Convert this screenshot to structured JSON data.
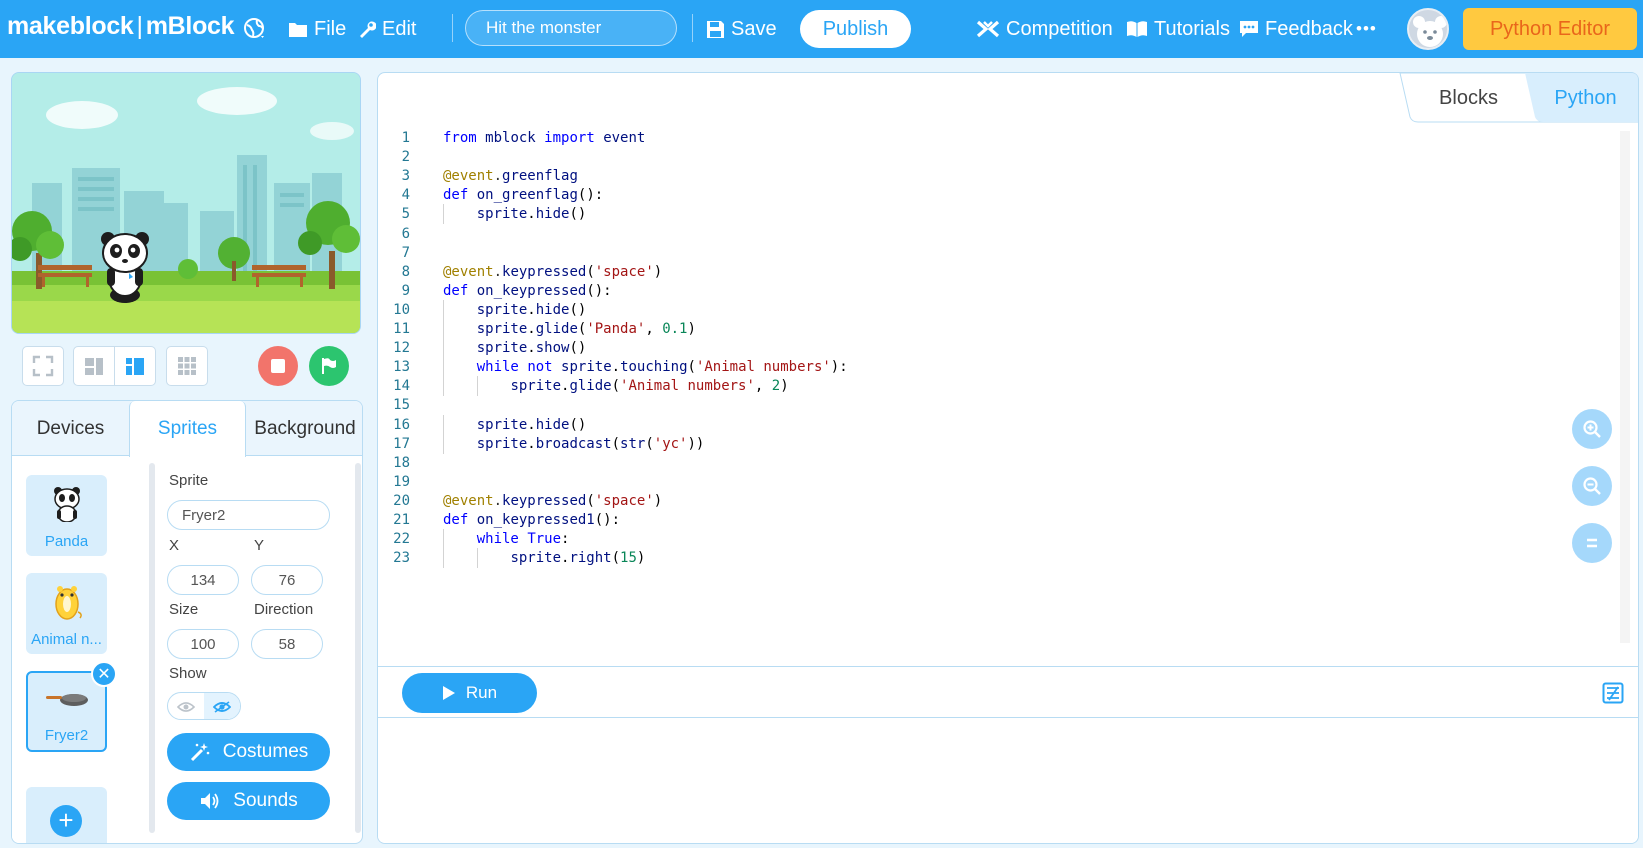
{
  "app": {
    "brand_left": "makeblock",
    "brand_sep": "|",
    "brand_right": "mBlock"
  },
  "topbar": {
    "file_label": "File",
    "edit_label": "Edit",
    "project_name": "Hit the monster",
    "save_label": "Save",
    "publish_label": "Publish",
    "competition_label": "Competition",
    "tutorials_label": "Tutorials",
    "feedback_label": "Feedback",
    "more_label": "•••",
    "python_editor_label": "Python Editor"
  },
  "left_panel": {
    "tabs": [
      {
        "label": "Devices",
        "active": false
      },
      {
        "label": "Sprites",
        "active": true
      },
      {
        "label": "Background",
        "active": false
      }
    ],
    "sprites": [
      {
        "label": "Panda",
        "selected": false
      },
      {
        "label": "Animal n...",
        "selected": false
      },
      {
        "label": "Fryer2",
        "selected": true
      }
    ],
    "add_label": "+",
    "delete_label": "✕",
    "props": {
      "sprite_label": "Sprite",
      "sprite_value": "Fryer2",
      "x_label": "X",
      "x_value": "134",
      "y_label": "Y",
      "y_value": "76",
      "size_label": "Size",
      "size_value": "100",
      "direction_label": "Direction",
      "direction_value": "58",
      "show_label": "Show",
      "costumes_label": "Costumes",
      "sounds_label": "Sounds"
    }
  },
  "editor": {
    "mode_tabs": [
      {
        "label": "Blocks",
        "active": false
      },
      {
        "label": "Python",
        "active": true
      }
    ],
    "run_label": "Run",
    "code_lines": [
      {
        "n": "1",
        "text": "from mblock import event"
      },
      {
        "n": "2",
        "text": ""
      },
      {
        "n": "3",
        "text": "@event.greenflag"
      },
      {
        "n": "4",
        "text": "def on_greenflag():"
      },
      {
        "n": "5",
        "text": "    sprite.hide()"
      },
      {
        "n": "6",
        "text": ""
      },
      {
        "n": "7",
        "text": ""
      },
      {
        "n": "8",
        "text": "@event.keypressed('space')"
      },
      {
        "n": "9",
        "text": "def on_keypressed():"
      },
      {
        "n": "10",
        "text": "    sprite.hide()"
      },
      {
        "n": "11",
        "text": "    sprite.glide('Panda', 0.1)"
      },
      {
        "n": "12",
        "text": "    sprite.show()"
      },
      {
        "n": "13",
        "text": "    while not sprite.touching('Animal numbers'):"
      },
      {
        "n": "14",
        "text": "        sprite.glide('Animal numbers', 2)"
      },
      {
        "n": "15",
        "text": ""
      },
      {
        "n": "16",
        "text": "    sprite.hide()"
      },
      {
        "n": "17",
        "text": "    sprite.broadcast(str('yc'))"
      },
      {
        "n": "18",
        "text": ""
      },
      {
        "n": "19",
        "text": ""
      },
      {
        "n": "20",
        "text": "@event.keypressed('space')"
      },
      {
        "n": "21",
        "text": "def on_keypressed1():"
      },
      {
        "n": "22",
        "text": "    while True:"
      },
      {
        "n": "23",
        "text": "        sprite.right(15)"
      }
    ]
  },
  "colors": {
    "accent": "#2aa5f5",
    "python_editor_bg": "#ffc940",
    "python_editor_text": "#e9661b",
    "stop": "#f2746b",
    "go": "#2cc56f"
  }
}
